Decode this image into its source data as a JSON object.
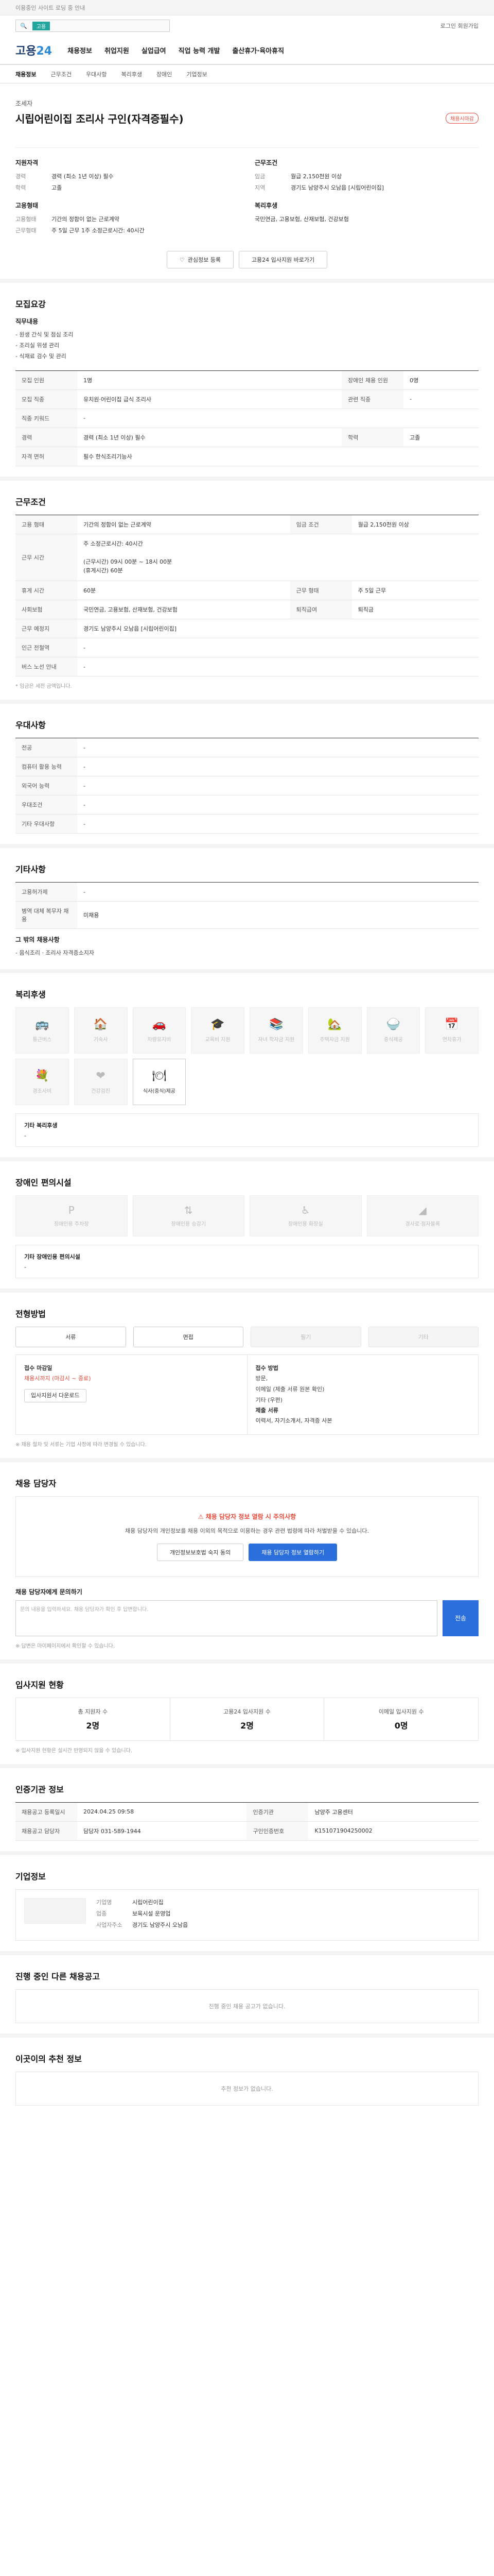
{
  "alert": "이용중인 사이트 로딩 중 안내",
  "top": {
    "tag": "고용",
    "links": "로그인  회원가입"
  },
  "logo": {
    "a": "고용",
    "b": "24"
  },
  "gnb": [
    "채용정보",
    "취업지원",
    "실업급여",
    "직업 능력 개발",
    "출산휴가·육아휴직"
  ],
  "subnav": [
    "채용정보",
    "근무조건",
    "우대사항",
    "복리후생",
    "장애인",
    "기업정보"
  ],
  "job": {
    "company": "조세자",
    "title": "시립어린이집 조리사 구인(자격증필수)",
    "badge": "채용시마감",
    "summary_left_title": "지원자격",
    "summary_left": [
      {
        "k": "경력",
        "v": "경력 (최소 1년 이상) 필수"
      },
      {
        "k": "학력",
        "v": "고졸"
      }
    ],
    "summary_right_title": "근무조건",
    "summary_right": [
      {
        "k": "임금",
        "v": "월급 2,150천원 이상"
      },
      {
        "k": "지역",
        "v": "경기도 남양주시 오남읍 [시립어린이집]"
      }
    ],
    "form_title": "고용형태",
    "form": [
      {
        "k": "고용형태",
        "v": "기간의 정함이 없는 근로계약"
      },
      {
        "k": "근무형태",
        "v": "주 5일 근무 1주 소정근로시간: 40시간"
      }
    ],
    "welfare_title": "복리후생",
    "welfare_v": "국민연금, 고용보험, 산재보험, 건강보험",
    "btn_save": "관심정보 등록",
    "btn_apply": "고용24 입사지원 바로가기"
  },
  "recruit": {
    "title": "모집요강",
    "duty_title": "직무내용",
    "duty_text": "- 원생 간식 및 점심 조리\n- 조리실 위생 관리\n- 식재료 검수 및 관리",
    "rows": [
      {
        "k": "모집 인원",
        "v": "1명",
        "k2": "장애인 채용 인원",
        "v2": "0명"
      },
      {
        "k": "모집 직종",
        "v": "유치원·어린이집 급식 조리사",
        "k2": "관련 직종",
        "v2": "-"
      },
      {
        "k": "직종 키워드",
        "v": "-",
        "k2": "",
        "v2": ""
      },
      {
        "k": "경력",
        "v": "경력 (최소 1년 이상) 필수",
        "k2": "학력",
        "v2": "고졸"
      },
      {
        "k": "자격 면허",
        "v": "필수  한식조리기능사",
        "k2": "",
        "v2": ""
      }
    ]
  },
  "conditions": {
    "title": "근무조건",
    "rows": [
      {
        "k": "고용 형태",
        "v": "기간의 정함이 없는 근로계약",
        "k2": "임금 조건",
        "v2": "월급 2,150천원 이상"
      },
      {
        "k": "근무 시간",
        "v": "주 소정근로시간: 40시간\n\n(근무시간) 09시 00분 ~ 18시 00분\n(휴게시간) 60분",
        "k2": "",
        "v2": ""
      },
      {
        "k": "휴게 시간",
        "v": "60분",
        "k2": "근무 형태",
        "v2": "주 5일 근무"
      },
      {
        "k": "사회보험",
        "v": "국민연금, 고용보험, 산재보험, 건강보험",
        "k2": "퇴직급여",
        "v2": "퇴직금"
      },
      {
        "k": "근무 예정지",
        "v": "경기도 남양주시 오남읍 [시립어린이집]",
        "k2": "",
        "v2": ""
      },
      {
        "k": "인근 전철역",
        "v": "-",
        "k2": "",
        "v2": ""
      },
      {
        "k": "버스 노선 안내",
        "v": "-",
        "k2": "",
        "v2": ""
      }
    ],
    "note": "* 임금은 세전 금액입니다."
  },
  "preference": {
    "title": "우대사항",
    "rows": [
      {
        "k": "전공",
        "v": "-"
      },
      {
        "k": "컴퓨터 활용 능력",
        "v": "-"
      },
      {
        "k": "외국어 능력",
        "v": "-"
      },
      {
        "k": "우대조건",
        "v": "-"
      },
      {
        "k": "기타 우대사항",
        "v": "-"
      }
    ]
  },
  "etc": {
    "title": "기타사항",
    "rows": [
      {
        "k": "고용허가제",
        "v": "-"
      },
      {
        "k": "병역 대체 복무자 채용",
        "v": "미채용"
      }
    ],
    "other_title": "그 밖의 채용사항",
    "other_text": "- 음식조리 · 조리사 자격증소지자"
  },
  "welfare": {
    "title": "복리후생",
    "items": [
      {
        "name": "통근버스",
        "icon": "🚌",
        "on": false
      },
      {
        "name": "기숙사",
        "icon": "🏠",
        "on": false
      },
      {
        "name": "차량유지비",
        "icon": "🚗",
        "on": false
      },
      {
        "name": "교육비 지원",
        "icon": "🎓",
        "on": false
      },
      {
        "name": "자녀 학자금 지원",
        "icon": "📚",
        "on": false
      },
      {
        "name": "주택자금 지원",
        "icon": "🏡",
        "on": false
      },
      {
        "name": "중식제공",
        "icon": "🍚",
        "on": false
      },
      {
        "name": "연차휴가",
        "icon": "📅",
        "on": false
      },
      {
        "name": "경조사비",
        "icon": "💐",
        "on": false
      },
      {
        "name": "건강검진",
        "icon": "❤",
        "on": false
      },
      {
        "name": "식사(중식)제공",
        "icon": "🍽",
        "on": true
      }
    ],
    "other_title": "기타 복리후생",
    "other_text": "-"
  },
  "facility": {
    "title": "장애인 편의시설",
    "items": [
      "장애인용 주차장",
      "장애인용 승강기",
      "장애인용 화장실",
      "경사로·점자블록"
    ],
    "other_title": "기타 장애인용 편의시설",
    "other_text": "-"
  },
  "process": {
    "title": "전형방법",
    "steps": [
      {
        "label": "서류",
        "dim": false
      },
      {
        "label": "면접",
        "dim": false
      },
      {
        "label": "필기",
        "dim": true
      },
      {
        "label": "기타",
        "dim": true
      }
    ],
    "deadline_title": "접수 마감일",
    "deadline": "채용시까지 (마감시 ~ 종료)",
    "docs_btn": "입사지원서 다운로드",
    "method_title": "접수 방법",
    "method_text": "방문,\n이메일 (제출 서류 원본 확인)\n기타 (우편)",
    "submit_title": "제출 서류",
    "submit_text": "이력서, 자기소개서, 자격증 사본",
    "note": "※ 채용 절차 및 서류는 기업 사정에 따라 변경될 수 있습니다."
  },
  "contact": {
    "title": "채용 담당자",
    "warn": "채용 담당자 정보 열람 시 주의사항",
    "desc": "채용 담당자의 개인정보를 채용 이외의 목적으로 이용하는 경우 관련 법령에 따라 처벌받을 수 있습니다.",
    "btn1": "개인정보보호법 숙지 동의",
    "btn2": "채용 담당자 정보 열람하기",
    "qna_title": "채용 담당자에게 문의하기",
    "qna_placeholder": "문의 내용을 입력하세요. 채용 담당자가 확인 후 답변합니다.",
    "qna_btn": "전송",
    "qna_note": "※ 답변은 마이페이지에서 확인할 수 있습니다."
  },
  "stats": {
    "title": "입사지원 현황",
    "items": [
      {
        "label": "총 지원자 수",
        "num": "2명"
      },
      {
        "label": "고용24 입사지원 수",
        "num": "2명"
      },
      {
        "label": "이메일 입사지원 수",
        "num": "0명"
      }
    ],
    "note": "※ 입사지원 현황은 실시간 반영되지 않을 수 있습니다."
  },
  "info": {
    "title": "인증기관 정보",
    "rows": [
      {
        "k": "채용공고 등록일시",
        "v": "2024.04.25 09:58",
        "k2": "인증기관",
        "v2": "남양주 고용센터"
      },
      {
        "k": "채용공고 담당자",
        "v": "담당자 031-589-1944",
        "k2": "구인인증번호",
        "v2": "K151071904250002"
      }
    ]
  },
  "company": {
    "title": "기업정보",
    "rows": [
      {
        "k": "기업명",
        "v": "시립어린이집"
      },
      {
        "k": "업종",
        "v": "보육시설 운영업"
      },
      {
        "k": "사업자주소",
        "v": "경기도 남양주시 오남읍"
      }
    ]
  },
  "related": {
    "title": "진행 중인 다른 채용공고",
    "empty": "진행 중인 채용 공고가 없습니다."
  },
  "recommend": {
    "title": "이곳이의 추천 정보",
    "empty": "추천 정보가 없습니다."
  }
}
